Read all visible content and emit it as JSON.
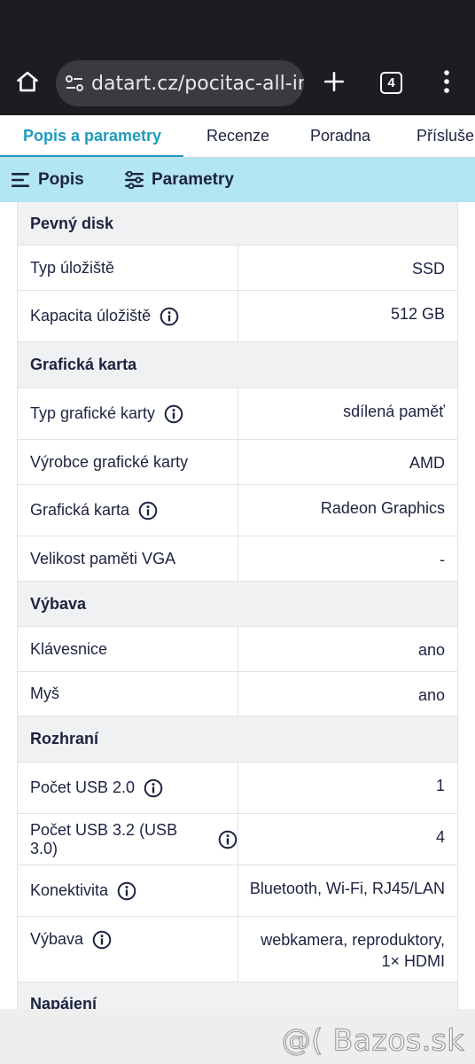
{
  "browser": {
    "url": "datart.cz/pocitac-all-in-",
    "tab_count": "4"
  },
  "page_tabs": [
    {
      "label": "Popis a parametry",
      "active": true
    },
    {
      "label": "Recenze",
      "active": false
    },
    {
      "label": "Poradna",
      "active": false
    },
    {
      "label": "Příslušen",
      "active": false
    }
  ],
  "subnav": {
    "popis": "Popis",
    "parametry": "Parametry"
  },
  "sections": {
    "disk": {
      "title": "Pevný disk",
      "rows": [
        {
          "label": "Typ úložiště",
          "value": "SSD",
          "info": false
        },
        {
          "label": "Kapacita úložiště",
          "value": "512 GB",
          "info": true
        }
      ]
    },
    "graphics": {
      "title": "Grafická karta",
      "rows": [
        {
          "label": "Typ grafické karty",
          "value": "sdílená paměť",
          "info": true
        },
        {
          "label": "Výrobce grafické karty",
          "value": "AMD",
          "info": false
        },
        {
          "label": "Grafická karta",
          "value": "Radeon Graphics",
          "info": true
        },
        {
          "label": "Velikost paměti VGA",
          "value": "-",
          "info": false
        }
      ]
    },
    "equipment": {
      "title": "Výbava",
      "rows": [
        {
          "label": "Klávesnice",
          "value": "ano",
          "info": false
        },
        {
          "label": "Myš",
          "value": "ano",
          "info": false
        }
      ]
    },
    "interface": {
      "title": "Rozhraní",
      "rows": [
        {
          "label": "Počet USB 2.0",
          "value": "1",
          "info": true
        },
        {
          "label": "Počet USB 3.2 (USB 3.0)",
          "value": "4",
          "info": true
        },
        {
          "label": "Konektivita",
          "value": "Bluetooth, Wi-Fi, RJ45/LAN",
          "info": true
        },
        {
          "label": "Výbava",
          "value_line1": "webkamera, reproduktory,",
          "value_line2": "1× HDMI",
          "info": true
        }
      ]
    },
    "power": {
      "title": "Napájení"
    }
  },
  "watermark": "@( Bazos.sk",
  "colors": {
    "accent": "#1e9bbf",
    "subnav_bg": "#b2e6f0",
    "section_bg": "#eff1f3",
    "text": "#1c2340",
    "chrome_bg": "#1c1d21"
  }
}
